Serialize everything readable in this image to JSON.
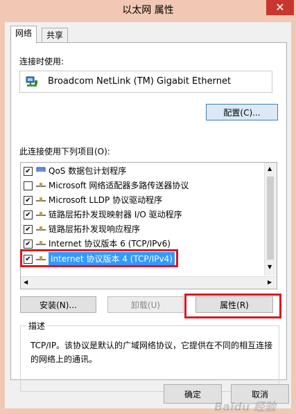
{
  "window": {
    "title": "以太网 属性",
    "close": "✕"
  },
  "tabs": [
    {
      "label": "网络"
    },
    {
      "label": "共享"
    }
  ],
  "connect_using_label": "连接时使用:",
  "adapter_name": "Broadcom NetLink (TM) Gigabit Ethernet",
  "configure_button": "配置(C)...",
  "items_label": "此连接使用下列项目(O):",
  "items": [
    {
      "checked": "✔",
      "text": "QoS 数据包计划程序"
    },
    {
      "checked": "",
      "text": "Microsoft 网络适配器多路传送器协议"
    },
    {
      "checked": "✔",
      "text": "Microsoft LLDP 协议驱动程序"
    },
    {
      "checked": "✔",
      "text": "链路层拓扑发现映射器 I/O 驱动程序"
    },
    {
      "checked": "✔",
      "text": "链路层拓扑发现响应程序"
    },
    {
      "checked": "✔",
      "text": "Internet 协议版本 6 (TCP/IPv6)"
    },
    {
      "checked": "✔",
      "text": "Internet 协议版本 4 (TCP/IPv4)"
    }
  ],
  "buttons": {
    "install": "安装(N)...",
    "uninstall": "卸载(U)",
    "properties": "属性(R)"
  },
  "description": {
    "title": "描述",
    "text": "TCP/IP。该协议是默认的广域网络协议，它提供在不同的相互连接的网络上的通讯。"
  },
  "footer": {
    "ok": "确定",
    "cancel": "取消"
  },
  "watermark": "Baidu 经验",
  "colors": {
    "highlight": "#e0141e",
    "selection": "#3399ff"
  }
}
